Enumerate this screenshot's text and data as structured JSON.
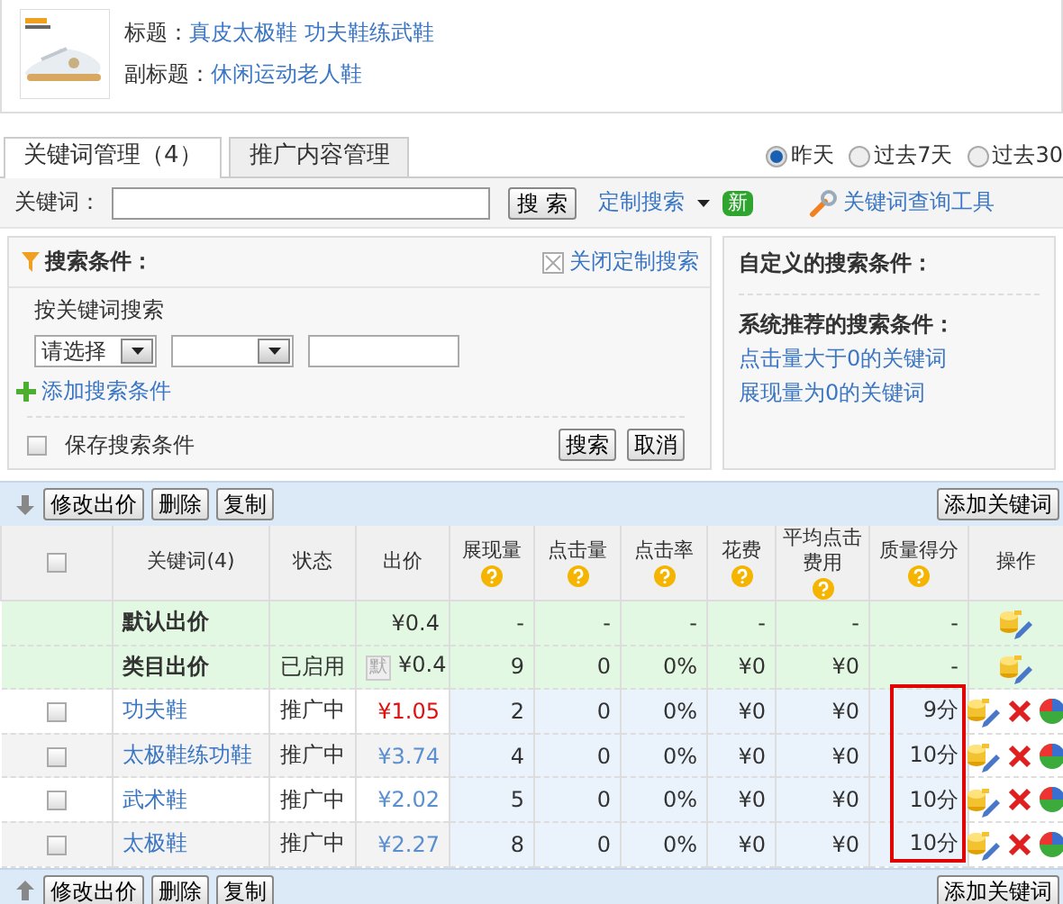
{
  "product": {
    "title_label": "标题：",
    "title": "真皮太极鞋 功夫鞋练武鞋",
    "subtitle_label": "副标题：",
    "subtitle": "休闲运动老人鞋"
  },
  "tabs": [
    {
      "label": "关键词管理（4）",
      "selected": true
    },
    {
      "label": "推广内容管理",
      "selected": false
    }
  ],
  "date_range": [
    {
      "label": "昨天",
      "selected": true
    },
    {
      "label": "过去7天",
      "selected": false
    },
    {
      "label": "过去30",
      "selected": false
    }
  ],
  "keyword_search": {
    "label": "关键词：",
    "button": "搜 索",
    "custom_search": "定制搜索",
    "new_badge": "新",
    "tool_link": "关键词查询工具"
  },
  "search_conditions": {
    "title": "搜索条件：",
    "close_link": "关闭定制搜索",
    "section": "按关键词搜索",
    "select_1": "请选择",
    "add_link": "添加搜索条件",
    "save_label": "保存搜索条件",
    "save_checked": false,
    "search_button": "搜索",
    "cancel_button": "取消"
  },
  "custom_conditions": {
    "title": "自定义的搜索条件：",
    "recommended_title": "系统推荐的搜索条件：",
    "links": [
      "点击量大于0的关键词",
      "展现量为0的关键词"
    ]
  },
  "toolbar": {
    "buttons": [
      "修改出价",
      "删除",
      "复制"
    ],
    "add_button": "添加关键词"
  },
  "table": {
    "select_all_checked": false,
    "columns": [
      {
        "label": "关键词(4)",
        "help": false
      },
      {
        "label": "状态",
        "help": false
      },
      {
        "label": "出价",
        "help": false
      },
      {
        "label": "展现量",
        "help": true
      },
      {
        "label": "点击量",
        "help": true
      },
      {
        "label": "点击率",
        "help": true
      },
      {
        "label": "花费",
        "help": true
      },
      {
        "label": "平均点击费用",
        "help": true
      },
      {
        "label": "质量得分",
        "help": true
      },
      {
        "label": "操作",
        "help": false
      }
    ],
    "rows": [
      {
        "kind": "preset",
        "keyword": "默认出价",
        "bid": "¥0.4",
        "impressions": "-",
        "clicks": "-",
        "ctr": "-",
        "cost": "-",
        "avg_cpc": "-",
        "quality": "-"
      },
      {
        "kind": "preset",
        "keyword": "类目出价",
        "status": "已启用",
        "bid_tag": "默",
        "bid": "¥0.4",
        "impressions": "9",
        "clicks": "0",
        "ctr": "0%",
        "cost": "¥0",
        "avg_cpc": "¥0",
        "quality": "-"
      },
      {
        "kind": "keyword",
        "checked": false,
        "bid_edited": true,
        "keyword": "功夫鞋",
        "status": "推广中",
        "bid": "¥1.05",
        "impressions": "2",
        "clicks": "0",
        "ctr": "0%",
        "cost": "¥0",
        "avg_cpc": "¥0",
        "quality": "9分"
      },
      {
        "kind": "keyword",
        "checked": false,
        "bid_edited": false,
        "keyword": "太极鞋练功鞋",
        "status": "推广中",
        "bid": "¥3.74",
        "impressions": "4",
        "clicks": "0",
        "ctr": "0%",
        "cost": "¥0",
        "avg_cpc": "¥0",
        "quality": "10分"
      },
      {
        "kind": "keyword",
        "checked": false,
        "bid_edited": false,
        "keyword": "武术鞋",
        "status": "推广中",
        "bid": "¥2.02",
        "impressions": "5",
        "clicks": "0",
        "ctr": "0%",
        "cost": "¥0",
        "avg_cpc": "¥0",
        "quality": "10分"
      },
      {
        "kind": "keyword",
        "checked": false,
        "bid_edited": false,
        "keyword": "太极鞋",
        "status": "推广中",
        "bid": "¥2.27",
        "impressions": "8",
        "clicks": "0",
        "ctr": "0%",
        "cost": "¥0",
        "avg_cpc": "¥0",
        "quality": "10分"
      }
    ]
  },
  "bottom_toolbar": {
    "buttons": [
      "修改出价",
      "删除",
      "复制"
    ],
    "add_button": "添加关键词"
  }
}
